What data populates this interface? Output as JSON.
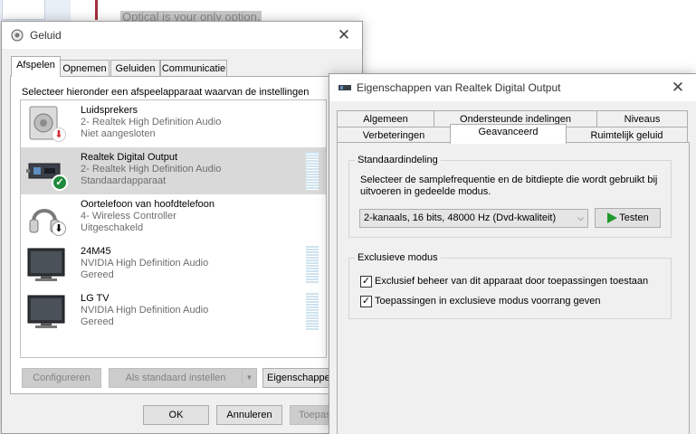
{
  "background": {
    "text": "Optical is your only option."
  },
  "geluid": {
    "title": "Geluid",
    "close_glyph": "✕",
    "tabs": [
      {
        "label": "Afspelen",
        "active": true
      },
      {
        "label": "Opnemen",
        "active": false
      },
      {
        "label": "Geluiden",
        "active": false
      },
      {
        "label": "Communicatie",
        "active": false
      }
    ],
    "instruction": "Selecteer hieronder een afspeelapparaat waarvan de instellingen moeten worden aangepast:",
    "devices": [
      {
        "name": "Luidsprekers",
        "line2": "2- Realtek High Definition Audio",
        "line3": "Niet aangesloten",
        "icon": "speaker-icon",
        "badge": "red-down-arrow-badge",
        "selected": false,
        "meter": false
      },
      {
        "name": "Realtek Digital Output",
        "line2": "2- Realtek High Definition Audio",
        "line3": "Standaardapparaat",
        "icon": "digital-output-icon",
        "badge": "green-check-badge",
        "selected": true,
        "meter": true
      },
      {
        "name": "Oortelefoon van hoofdtelefoon",
        "line2": "4- Wireless Controller",
        "line3": "Uitgeschakeld",
        "icon": "headset-icon",
        "badge": "black-down-arrow-badge",
        "selected": false,
        "meter": false
      },
      {
        "name": "24M45",
        "line2": "NVIDIA High Definition Audio",
        "line3": "Gereed",
        "icon": "monitor-icon",
        "badge": "",
        "selected": false,
        "meter": true
      },
      {
        "name": "LG TV",
        "line2": "NVIDIA High Definition Audio",
        "line3": "Gereed",
        "icon": "monitor-icon",
        "badge": "",
        "selected": false,
        "meter": true
      }
    ],
    "buttons": {
      "configure": "Configureren",
      "set_default": "Als standaard instellen",
      "dropdown_arrow": "▼",
      "properties": "Eigenschappen",
      "ok": "OK",
      "cancel": "Annuleren",
      "apply": "Toepassen"
    }
  },
  "eigenschappen": {
    "title": "Eigenschappen van Realtek Digital Output",
    "close_glyph": "✕",
    "tabs_row1": [
      "Algemeen",
      "Ondersteunde indelingen",
      "Niveaus"
    ],
    "tabs_row2": [
      "Verbeteringen",
      "Geavanceerd",
      "Ruimtelijk geluid"
    ],
    "active_tab": "Geavanceerd",
    "default_format": {
      "legend": "Standaardindeling",
      "description": "Selecteer de samplefrequentie en de bitdiepte die wordt gebruikt bij uitvoeren in gedeelde modus.",
      "selected_format": "2-kanaals, 16 bits, 48000 Hz (Dvd-kwaliteit)",
      "test_button": "Testen"
    },
    "exclusive_mode": {
      "legend": "Exclusieve modus",
      "options": [
        {
          "label": "Exclusief beheer van dit apparaat door toepassingen toestaan",
          "checked": true
        },
        {
          "label": "Toepassingen in exclusieve modus voorrang geven",
          "checked": true
        }
      ],
      "check_glyph": "✓"
    }
  },
  "colors": {
    "selection": "#d9d9d9",
    "meter": "#cfe3f0",
    "check_badge": "#1f8a3b",
    "arrow_badge_red": "#d12c2c",
    "play_green": "#1f9a2e"
  }
}
